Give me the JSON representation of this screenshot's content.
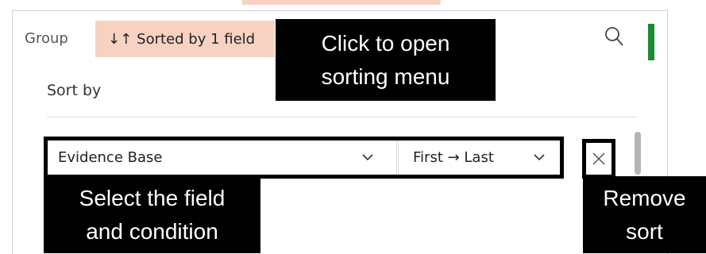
{
  "toolbar": {
    "group_label": "Group",
    "sort_chip_label": "Sorted by 1 field",
    "sort_chip_icon": "sort-arrows-icon",
    "search_icon": "search-icon",
    "chip_color": "#f7d2c2",
    "status_color": "#1c8a2e"
  },
  "sort_panel": {
    "heading": "Sort by",
    "field_value": "Evidence Base",
    "condition_value": "First → Last",
    "remove_icon": "close-icon"
  },
  "callouts": {
    "open_menu": [
      "Click to open",
      "sorting menu"
    ],
    "select_field": [
      "Select the field",
      "and condition"
    ],
    "remove_sort": [
      "Remove",
      "sort"
    ]
  }
}
